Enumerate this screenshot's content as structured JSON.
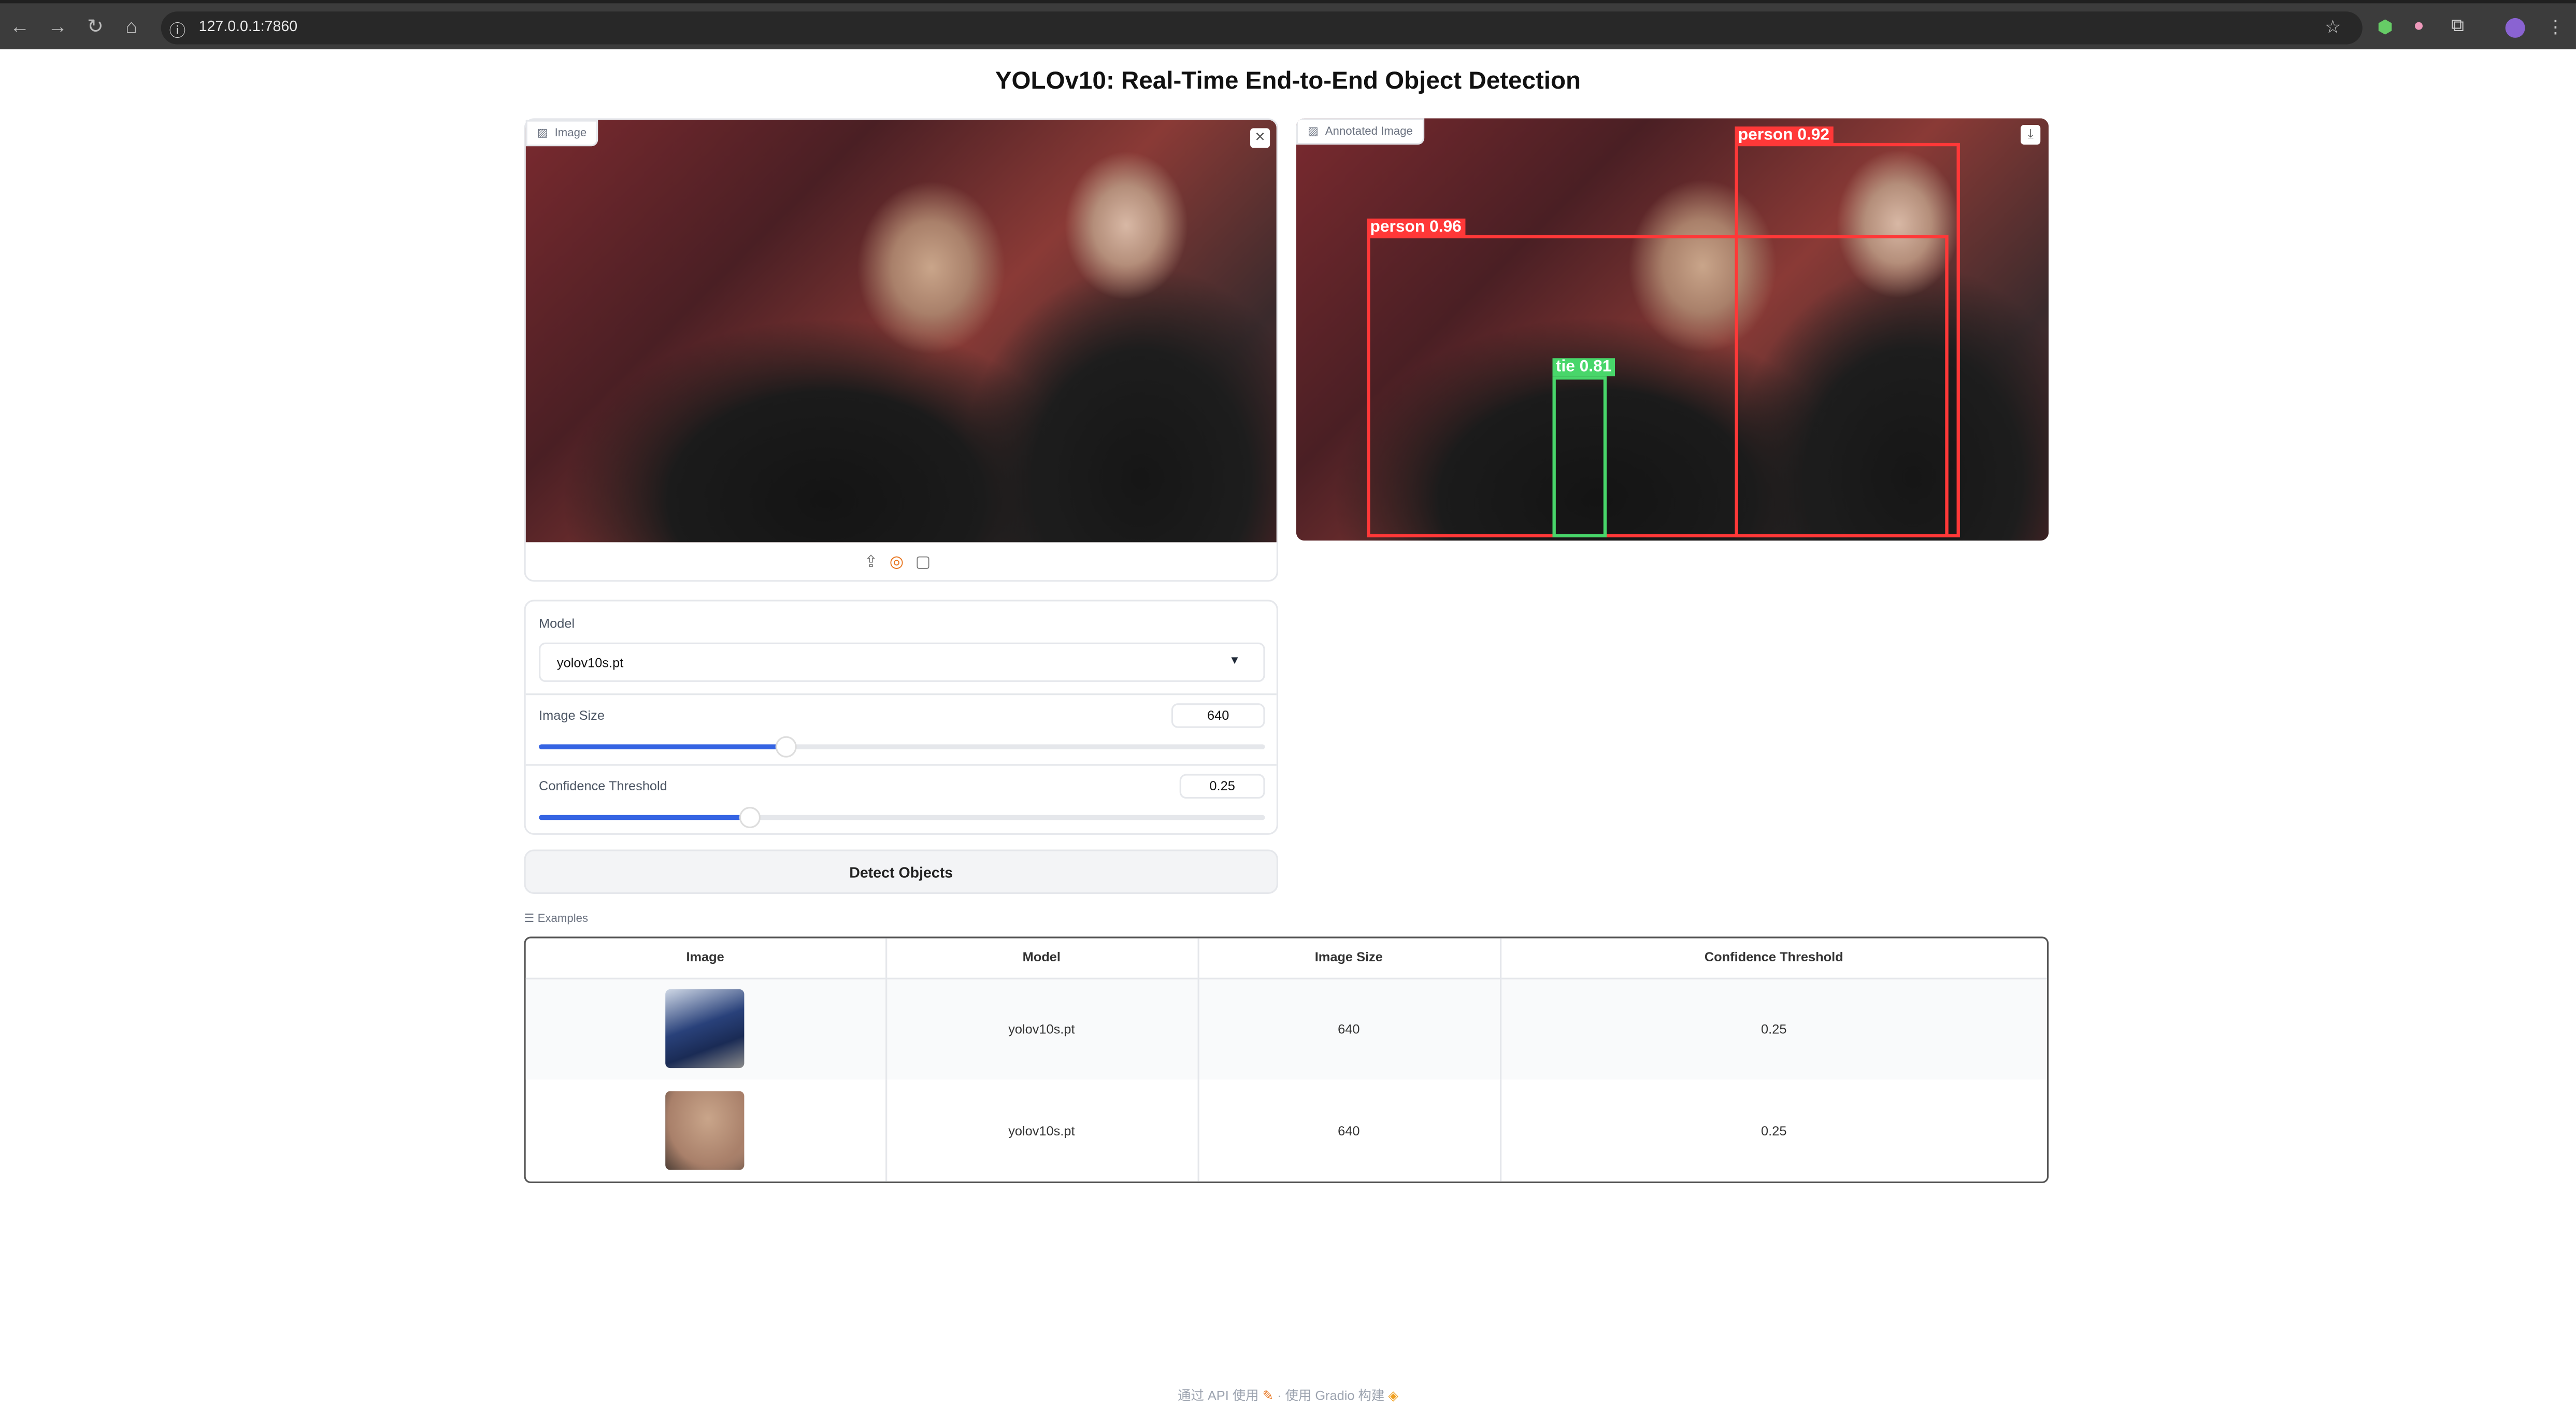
{
  "browser": {
    "url": "127.0.0.1:7860"
  },
  "title": "YOLOv10: Real-Time End-to-End Object Detection",
  "input_image": {
    "label": "Image",
    "sources": [
      "upload-icon",
      "webcam-icon",
      "clipboard-icon"
    ]
  },
  "output_image": {
    "label": "Annotated Image",
    "detections": [
      {
        "label": "person 0.92",
        "color": "#ff3838"
      },
      {
        "label": "person 0.96",
        "color": "#ff3838"
      },
      {
        "label": "tie 0.81",
        "color": "#48d66a"
      }
    ]
  },
  "controls": {
    "model": {
      "label": "Model",
      "value": "yolov10s.pt"
    },
    "image_size": {
      "label": "Image Size",
      "value": "640",
      "fraction": 0.34
    },
    "confidence": {
      "label": "Confidence Threshold",
      "value": "0.25",
      "fraction": 0.29
    }
  },
  "detect_button": "Detect Objects",
  "examples": {
    "label": "Examples",
    "headers": [
      "Image",
      "Model",
      "Image Size",
      "Confidence Threshold"
    ],
    "rows": [
      [
        "",
        "yolov10s.pt",
        "640",
        "0.25"
      ],
      [
        "",
        "yolov10s.pt",
        "640",
        "0.25"
      ]
    ]
  },
  "footer": {
    "api": "通过 API 使用",
    "sep": "·",
    "built": "使用 Gradio 构建"
  },
  "accent": "#3564e3"
}
